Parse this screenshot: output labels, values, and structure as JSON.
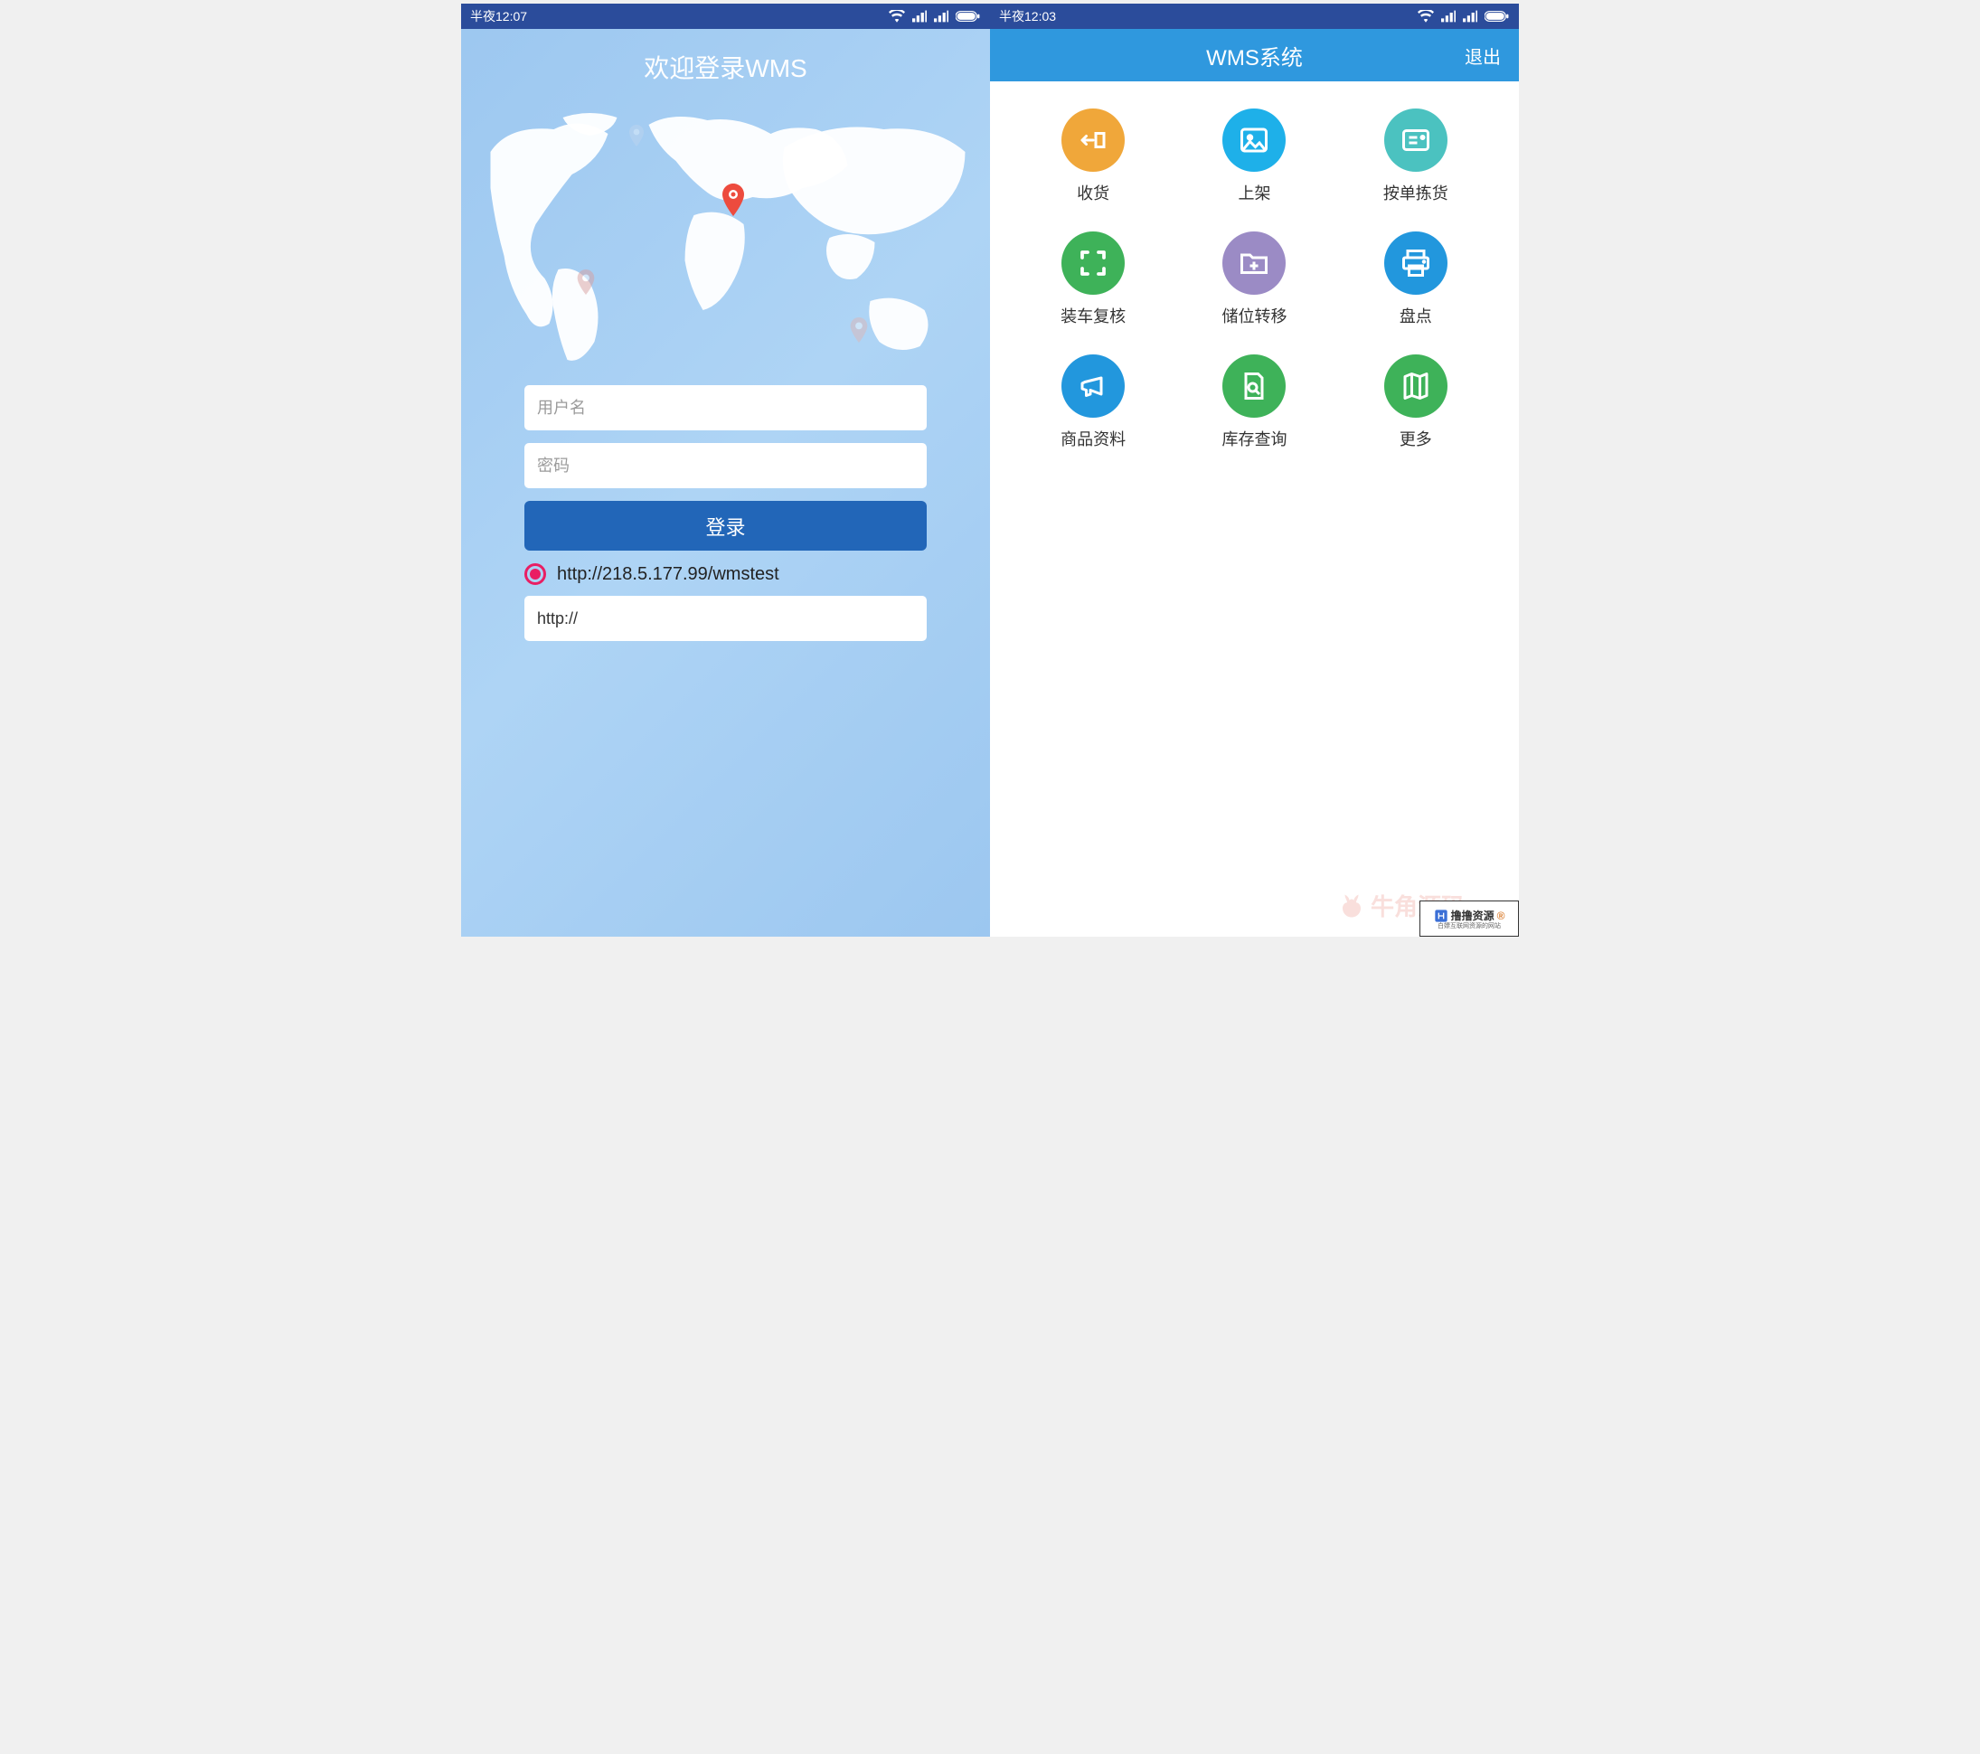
{
  "left": {
    "status_time": "半夜12:07",
    "header_title": "欢迎登录WMS",
    "form": {
      "username_placeholder": "用户名",
      "password_placeholder": "密码",
      "login_button": "登录",
      "server_radio_label": "http://218.5.177.99/wmstest",
      "url_value": "http://"
    }
  },
  "right": {
    "status_time": "半夜12:03",
    "app_title": "WMS系统",
    "exit_label": "退出",
    "menu": [
      {
        "label": "收货",
        "color": "#f0a73a",
        "icon": "receive"
      },
      {
        "label": "上架",
        "color": "#1eb0e9",
        "icon": "image"
      },
      {
        "label": "按单拣货",
        "color": "#4bc2c0",
        "icon": "card"
      },
      {
        "label": "装车复核",
        "color": "#3eb259",
        "icon": "scan"
      },
      {
        "label": "储位转移",
        "color": "#9b8bc5",
        "icon": "folder-plus"
      },
      {
        "label": "盘点",
        "color": "#2297dd",
        "icon": "printer"
      },
      {
        "label": "商品资料",
        "color": "#2297dd",
        "icon": "megaphone"
      },
      {
        "label": "库存查询",
        "color": "#3eb259",
        "icon": "doc-search"
      },
      {
        "label": "更多",
        "color": "#3eb259",
        "icon": "map"
      }
    ]
  },
  "watermarks": {
    "brand1": "牛角源码",
    "brand2": "撸撸资源",
    "brand2_sub": "白嫖互联网资源的网站"
  }
}
